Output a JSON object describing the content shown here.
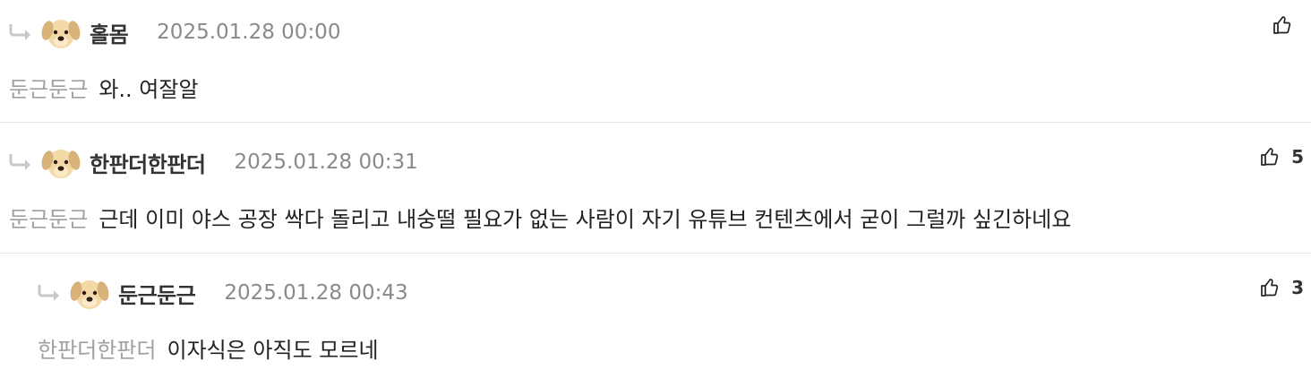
{
  "comments": [
    {
      "nickname": "홀몸",
      "date": "2025.01.28 00:00",
      "mention": "둔근둔근",
      "text": "와.. 여잘알",
      "likes": ""
    },
    {
      "nickname": "한판더한판더",
      "date": "2025.01.28 00:31",
      "mention": "둔근둔근",
      "text": "근데 이미 야스 공장 싹다 돌리고 내숭떨 필요가 없는 사람이 자기 유튜브 컨텐츠에서 굳이 그럴까 싶긴하네요",
      "likes": "5"
    },
    {
      "nickname": "둔근둔근",
      "date": "2025.01.28 00:43",
      "mention": "한판더한판더",
      "text": "이자식은 아직도 모르네",
      "likes": "3"
    }
  ],
  "icons": {
    "reply": "reply-arrow-icon",
    "avatar": "puppy-avatar-icon",
    "like": "thumbs-up-icon"
  }
}
